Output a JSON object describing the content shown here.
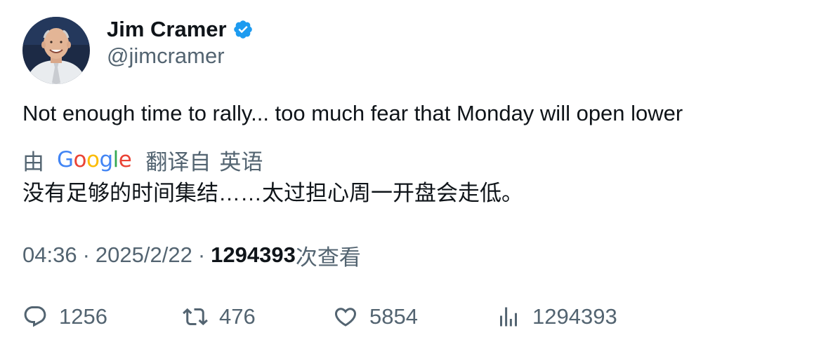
{
  "author": {
    "display_name": "Jim Cramer",
    "handle": "@jimcramer",
    "verified": true,
    "verified_color": "#1d9bf0",
    "avatar_icon": "profile-photo"
  },
  "tweet": {
    "text": "Not enough time to rally... too much fear that Monday will open lower"
  },
  "translation": {
    "prefix": "由",
    "provider": "Google",
    "suffix": "翻译自",
    "source_language": "英语",
    "text": "没有足够的时间集结……太过担心周一开盘会走低。"
  },
  "meta": {
    "time": "04:36",
    "separator": "·",
    "date": "2025/2/22",
    "views_count": "1294393",
    "views_label": "次查看"
  },
  "actions": {
    "replies": "1256",
    "retweets": "476",
    "likes": "5854",
    "views": "1294393"
  },
  "colors": {
    "text_primary": "#0f1419",
    "text_secondary": "#536471",
    "google_blue": "#4285F4",
    "google_red": "#EA4335",
    "google_yellow": "#FBBC05",
    "google_green": "#34A853"
  }
}
